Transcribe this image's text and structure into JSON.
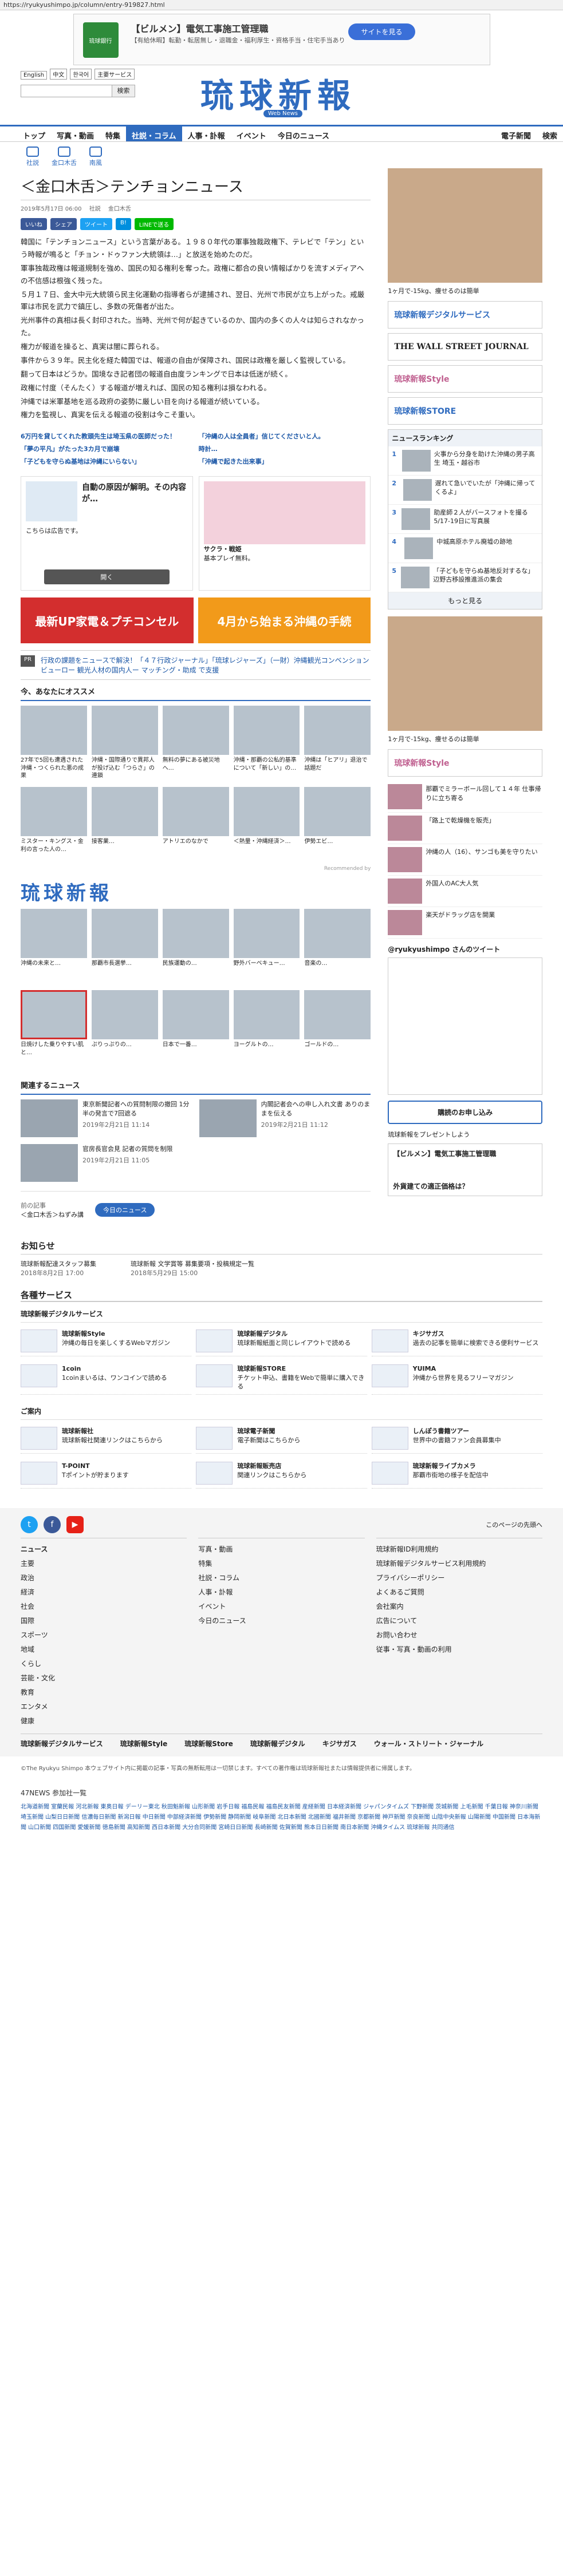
{
  "url": "https://ryukyushimpo.jp/column/entry-919827.html",
  "top_ad": {
    "logo": "琉球銀行",
    "title": "【ビルメン】電気工事施工管理職",
    "desc": "【有給休暇】転勤・転居無し・退職金・福利厚生・資格手当・住宅手当あり",
    "button": "サイトを見る"
  },
  "header": {
    "lang": [
      "English",
      "中文",
      "한국어"
    ],
    "search_placeholder": "",
    "search_btn": "検索",
    "service": "主要サービス",
    "logo": "琉球新報",
    "logo_sub": "Web News"
  },
  "gnav": [
    "トップ",
    "写真・動画",
    "特集",
    "社説・コラム",
    "人事・訃報",
    "イベント",
    "今日のニュース",
    "電子新聞",
    "検索"
  ],
  "gnav_active": "社説・コラム",
  "subnav": [
    "社説",
    "金口木舌",
    "南風"
  ],
  "article": {
    "title": "＜金口木舌＞テンチョンニュース",
    "date": "2019年5月17日 06:00",
    "tags": [
      "社説",
      "金口木舌",
      "金口木舌"
    ],
    "share": [
      "いいね",
      "シェア",
      "ツイート",
      "B!",
      "LINEで送る"
    ],
    "paragraphs": [
      "韓国に「テンチョンニュース」という言葉がある。１９８０年代の軍事独裁政権下、テレビで「テン」という時報が鳴ると「チョン・ドゥファン大統領は…」と放送を始めたのだ。",
      "軍事独裁政権は報道規制を強め、国民の知る権利を奪った。政権に都合の良い情報ばかりを流すメディアへの不信感は根強く残った。",
      "５月１７日、金大中元大統領ら民主化運動の指導者らが逮捕され、翌日、光州で市民が立ち上がった。戒厳軍は市民を武力で鎮圧し、多数の死傷者が出た。",
      "光州事件の真相は長く封印された。当時、光州で何が起きているのか、国内の多くの人々は知らされなかった。",
      "権力が報道を操ると、真実は闇に葬られる。",
      "事件から３９年。民主化を経た韓国では、報道の自由が保障され、国民は政権を厳しく監視している。",
      "翻って日本はどうか。国境なき記者団の報道自由度ランキングで日本は低迷が続く。",
      "政権に忖度（そんたく）する報道が増えれば、国民の知る権利は損なわれる。",
      "沖縄では米軍基地を巡る政府の姿勢に厳しい目を向ける報道が続いている。",
      "権力を監視し、真実を伝える報道の役割は今こそ重い。"
    ]
  },
  "related_links": [
    "6万円を貸してくれた教頭先生は埼玉県の医師だった！",
    "「沖縄の人は全員者」信じてくださいと人。",
    "「夢の平凡」がたった3カ月で崩壊",
    "時計…",
    "「子どもを守らぬ基地は沖縄にいらない」",
    "「沖縄で起きた出来事」"
  ],
  "ads": [
    {
      "title": "自動の原因が解明。その内容が…",
      "desc": "こちらは広告です。",
      "button": "開く"
    },
    {
      "title": "サクラ・戦姫",
      "desc": "基本プレイ無料。",
      "button": "開く"
    }
  ],
  "banner2": [
    "最新UP家電＆プチコンセル",
    "4月から始まる沖縄の手続"
  ],
  "pr": {
    "tag": "PR",
    "text": "行政の課題をニュースで解決！「４７行政ジャーナル」「琉球レジャーズ」（一財）沖縄観光コンベンションビューロー 観光人材の国内人ー マッチング・助成 で支援"
  },
  "recommend": {
    "header": "今、あなたにオススメ",
    "items": [
      "27年で5回も遭遇された沖縄・つくられた悪の成果",
      "沖縄・国際通りで異邦人が投げ込む「つらさ」の連鎖",
      "無料の夢にある被災地へ…",
      "沖縄・那覇の公私的基準について「新しい」の…",
      "沖縄は「ヒアリ」退治で話題だ",
      "ミスター・キングス・金利の言った人の…",
      "接客業…",
      "アトリエのなかで",
      "＜熱量・沖縄経済＞…",
      "伊勢エビ…"
    ],
    "footer": "Recommended by"
  },
  "ryuku_block": {
    "logo": "琉球新報",
    "items": [
      "沖縄の未来と…",
      "那覇市長選挙…",
      "民族運動の…",
      "野外バーベキュー…",
      "音楽の…"
    ],
    "items2": [
      "日焼けした乗りやすい肌と…",
      "ぷりっぷりの…",
      "日本で一番…",
      "ヨーグルトの…",
      "ゴールドの…"
    ]
  },
  "related_news": {
    "header": "関連するニュース",
    "items": [
      {
        "title": "東京新聞記者への質問制限の撤回 1分半の発言で7回遮る",
        "date": "2019年2月21日 11:14"
      },
      {
        "title": "内閣記者会への申し入れ文書 ありのままを伝える",
        "date": "2019年2月21日 11:12"
      },
      {
        "title": "官房長官会見 記者の質問を制限",
        "date": "2019年2月21日 11:05"
      }
    ]
  },
  "pager": {
    "prev_label": "前の記事",
    "prev_title": "＜金口木舌＞ねずみ講",
    "button": "今日のニュース"
  },
  "sidebar": {
    "ad_caption": "1ヶ月で-15kg、痩せるのは簡単",
    "banner_style": "琉球新報デジタルサービス",
    "wsj": "THE WALL STREET JOURNAL",
    "banner_style2": "琉球新報Style",
    "banner_store": "琉球新報STORE",
    "ranking_header": "ニュースランキング",
    "ranking": [
      {
        "n": "1",
        "title": "火事から分身を助けた沖縄の男子高生 埼玉・越谷市"
      },
      {
        "n": "2",
        "title": "遅れて急いでいたが「沖縄に帰ってくるよ」"
      },
      {
        "n": "3",
        "title": "助産師２人がバースフォトを撮る 5/17-19日に写真展"
      },
      {
        "n": "4",
        "title": "中城高原ホテル廃墟の跡地"
      },
      {
        "n": "5",
        "title": "「子どもを守らぬ基地反対するな」辺野古移設推進派の集会"
      }
    ],
    "more": "もっと見る",
    "style_items": [
      "那覇でミラーボール回して１４年 仕事帰りに立ち寄る",
      "「路上で乾燥機を販売」",
      "沖縄の人（16）、サンゴも美を守りたい",
      "外国人のAC大人気",
      "楽天がドラッグ店を開業"
    ],
    "twitter_header": "@ryukyushimpo さんのツイート",
    "subscribe": "購読のお申し込み",
    "present": "琉球新報をプレゼントしよう",
    "sidead": [
      "【ビルメン】電気工事施工管理職",
      "外貨建ての適正価格は？"
    ]
  },
  "notice": {
    "header": "お知らせ",
    "items": [
      {
        "title": "琉球新報配達スタッフ募集",
        "date": "2018年8月2日 17:00"
      },
      {
        "title": "琉球新報 文学賞等 募集要項・投稿規定一覧",
        "date": "2018年5月29日 15:00"
      }
    ]
  },
  "services": {
    "header": "各種サービス",
    "sub1": "琉球新報デジタルサービス",
    "items1": [
      {
        "name": "琉球新報Style",
        "desc": "沖縄の毎日を楽しくするWebマガジン"
      },
      {
        "name": "琉球新報デジタル",
        "desc": "琉球新報紙面と同じレイアウトで読める"
      },
      {
        "name": "キジサガス",
        "desc": "過去の記事を簡単に検索できる便利サービス"
      },
      {
        "name": "1coin",
        "desc": "1coinまいるは、ワンコインで読める"
      },
      {
        "name": "琉球新報STORE",
        "desc": "チケット申込、書籍をWebで簡単に購入できる"
      },
      {
        "name": "YUIMA",
        "desc": "沖縄から世界を見るフリーマガジン"
      }
    ],
    "sub2": "ご案内",
    "items2": [
      {
        "name": "琉球新報社",
        "desc": "琉球新報社関連リンクはこちらから"
      },
      {
        "name": "琉球電子新聞",
        "desc": "電子新聞はこちらから"
      },
      {
        "name": "しんぽう書籍ツアー",
        "desc": "世界中の書籍ファン会員募集中"
      },
      {
        "name": "T-POINT",
        "desc": "Tポイントが貯まります"
      },
      {
        "name": "琉球新報販売店",
        "desc": "関連リンクはこちらから"
      },
      {
        "name": "琉球新報ライブカメラ",
        "desc": "那覇市街地の様子を配信中"
      }
    ]
  },
  "footer": {
    "share_label": "このページの先頭へ",
    "col1": [
      "ニュース",
      "主要",
      "政治",
      "経済",
      "社会",
      "国際",
      "スポーツ",
      "地域",
      "くらし",
      "芸能・文化",
      "教育",
      "エンタメ",
      "健康"
    ],
    "col2": [
      "写真・動画",
      "特集",
      "社説・コラム",
      "人事・訃報",
      "イベント",
      "今日のニュース"
    ],
    "col3": [
      "琉球新報ID利用規約",
      "琉球新報デジタルサービス利用規約",
      "プライバシーポリシー",
      "よくあるご質問",
      "会社案内",
      "広告について",
      "お問い合わせ",
      "従事・写真・動画の利用"
    ],
    "bottom": [
      "琉球新報デジタルサービス",
      "琉球新報Style",
      "琉球新報Store",
      "琉球新報デジタル",
      "キジサガス",
      "ウォール・ストリート・ジャーナル"
    ]
  },
  "copyright": "©The Ryukyu Shimpo 本ウェブサイト内に掲載の記事・写真の無断転用は一切禁じます。すべての著作権は琉球新報社または情報提供者に帰属します。",
  "links47": {
    "header": "47NEWS 参加社一覧",
    "text": "北海道新聞 室蘭民報 河北新報 東奥日報 デーリー東北 秋田魁新報 山形新聞 岩手日報 福島民報 福島民友新聞 産経新聞 日本経済新聞 ジャパンタイムズ 下野新聞 茨城新聞 上毛新聞 千葉日報 神奈川新聞 埼玉新聞 山梨日日新聞 信濃毎日新聞 新潟日報 中日新聞 中部経済新聞 伊勢新聞 静岡新聞 岐阜新聞 北日本新聞 北國新聞 福井新聞 京都新聞 神戸新聞 奈良新聞 山陰中央新報 山陽新聞 中国新聞 日本海新聞 山口新聞 四国新聞 愛媛新聞 徳島新聞 高知新聞 西日本新聞 大分合同新聞 宮崎日日新聞 長崎新聞 佐賀新聞 熊本日日新聞 南日本新聞 沖縄タイムス 琉球新報 共同通信"
  },
  "colors": {
    "brand": "#2f6bbf"
  }
}
